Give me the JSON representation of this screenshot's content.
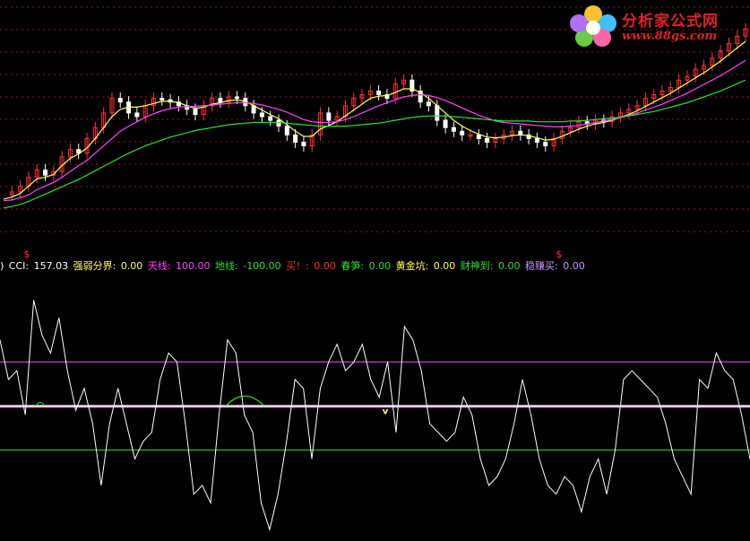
{
  "logo": {
    "title": "分析家公式网",
    "url": "www.88gs.com"
  },
  "legend": {
    "prefix": ")",
    "cci_label": "CCI: ",
    "cci_value": "157.03",
    "boundary_label": "强弱分界: ",
    "boundary_value": "0.00",
    "upper_label": "天线: ",
    "upper_value": "100.00",
    "lower_label": "地线: ",
    "lower_value": "-100.00",
    "buy_label": "买！: ",
    "buy_value": "0.00",
    "spring_label": "春笋: ",
    "spring_value": "0.00",
    "pit_label": "黄金坑: ",
    "pit_value": "0.00",
    "wealth_label": "财神到: ",
    "wealth_value": "0.00",
    "steady_label": "稳赚买: ",
    "steady_value": "0.00"
  },
  "signals": {
    "buy_marker": "$",
    "pit_marker": "v"
  },
  "colors": {
    "background": "#000000",
    "up": "#ff3333",
    "down": "#ffffff",
    "ma_short": "#ffffff",
    "ma_mid": "#ffff66",
    "ma_long": "#ff44ff",
    "ma_longest": "#33dd33",
    "cci": "#ffffff",
    "upper": "#ff44ff",
    "boundary": "#ffffff",
    "lower": "#33dd33",
    "grid": "#aa2222",
    "label_white": "#ffffff",
    "label_yellow": "#ffff66",
    "label_magenta": "#ff44ff",
    "label_green": "#33dd33",
    "label_red": "#ff3333",
    "label_purple": "#cc99ff"
  },
  "chart_data": [
    {
      "type": "candlestick",
      "title": "",
      "series": [
        {
          "values": [
            18,
            22,
            30,
            42,
            52,
            45,
            50,
            70,
            80,
            75,
            95,
            110,
            130,
            150,
            145,
            130,
            125,
            140,
            150,
            148,
            145,
            140,
            135,
            128,
            140,
            150,
            145,
            152,
            150,
            140,
            130,
            125,
            120,
            112,
            100,
            90,
            85,
            100,
            130,
            120,
            125,
            140,
            150,
            155,
            160,
            155,
            150,
            170,
            175,
            160,
            145,
            140,
            120,
            110,
            105,
            100,
            100,
            95,
            90,
            95,
            100,
            105,
            100,
            95,
            90,
            85,
            95,
            105,
            110,
            118,
            115,
            120,
            118,
            125,
            130,
            135,
            140,
            150,
            155,
            160,
            165,
            175,
            180,
            190,
            195,
            205,
            215,
            225,
            235,
            245
          ]
        },
        {
          "values": [
            12,
            15,
            20,
            30,
            40,
            42,
            46,
            58,
            68,
            74,
            82,
            95,
            110,
            125,
            135,
            138,
            138,
            140,
            143,
            146,
            146,
            144,
            140,
            136,
            138,
            142,
            144,
            147,
            148,
            146,
            140,
            134,
            128,
            122,
            114,
            105,
            98,
            98,
            108,
            113,
            118,
            126,
            134,
            142,
            150,
            153,
            154,
            158,
            163,
            163,
            158,
            150,
            140,
            130,
            120,
            112,
            106,
            101,
            97,
            96,
            97,
            99,
            100,
            99,
            96,
            93,
            94,
            98,
            103,
            108,
            112,
            115,
            117,
            120,
            124,
            128,
            133,
            139,
            145,
            151,
            157,
            164,
            171,
            178,
            185,
            193,
            201,
            210,
            219,
            228
          ]
        },
        {
          "values": [
            10,
            11,
            14,
            18,
            25,
            30,
            35,
            42,
            50,
            58,
            65,
            75,
            85,
            95,
            105,
            112,
            118,
            124,
            129,
            133,
            136,
            138,
            139,
            139,
            140,
            141,
            142,
            143,
            144,
            144,
            143,
            141,
            138,
            135,
            131,
            126,
            121,
            118,
            117,
            117,
            118,
            121,
            125,
            130,
            135,
            140,
            144,
            148,
            152,
            154,
            155,
            154,
            151,
            147,
            142,
            137,
            132,
            127,
            123,
            119,
            117,
            116,
            115,
            114,
            113,
            112,
            111,
            111,
            112,
            113,
            115,
            117,
            119,
            121,
            124,
            127,
            130,
            134,
            138,
            142,
            147,
            152,
            157,
            163,
            169,
            175,
            181,
            188,
            195,
            202
          ]
        },
        {
          "values": [
            0,
            2,
            5,
            9,
            14,
            19,
            24,
            29,
            34,
            39,
            45,
            51,
            57,
            63,
            69,
            75,
            80,
            85,
            89,
            93,
            97,
            100,
            103,
            106,
            108,
            110,
            112,
            114,
            115,
            116,
            117,
            117,
            117,
            117,
            116,
            115,
            114,
            113,
            112,
            112,
            112,
            112,
            113,
            114,
            115,
            116,
            118,
            120,
            122,
            124,
            125,
            126,
            126,
            126,
            125,
            124,
            123,
            122,
            121,
            120,
            119,
            119,
            119,
            119,
            118,
            118,
            118,
            118,
            119,
            119,
            120,
            121,
            122,
            123,
            124,
            126,
            128,
            130,
            132,
            135,
            138,
            141,
            144,
            148,
            152,
            156,
            160,
            165,
            170,
            175
          ]
        }
      ]
    },
    {
      "type": "line",
      "title": "",
      "ylim": [
        -300,
        300
      ],
      "reference_lines": [
        100,
        0,
        -100
      ],
      "series": [
        {
          "name": "CCI",
          "values": [
            150,
            60,
            80,
            -20,
            240,
            160,
            120,
            200,
            80,
            -10,
            40,
            -40,
            -180,
            -40,
            40,
            -40,
            -120,
            -80,
            -60,
            60,
            120,
            100,
            -40,
            -200,
            -180,
            -220,
            -20,
            150,
            120,
            -20,
            -60,
            -220,
            -280,
            -200,
            -80,
            60,
            40,
            -120,
            40,
            100,
            140,
            80,
            100,
            140,
            60,
            20,
            100,
            -60,
            180,
            150,
            80,
            -40,
            -60,
            -80,
            -60,
            20,
            -20,
            -120,
            -180,
            -160,
            -120,
            -40,
            60,
            -20,
            -120,
            -180,
            -200,
            -160,
            -180,
            -240,
            -160,
            -120,
            -200,
            -100,
            60,
            80,
            60,
            40,
            20,
            -40,
            -120,
            -160,
            -200,
            60,
            40,
            120,
            80,
            60,
            -20,
            -120
          ]
        }
      ]
    }
  ]
}
